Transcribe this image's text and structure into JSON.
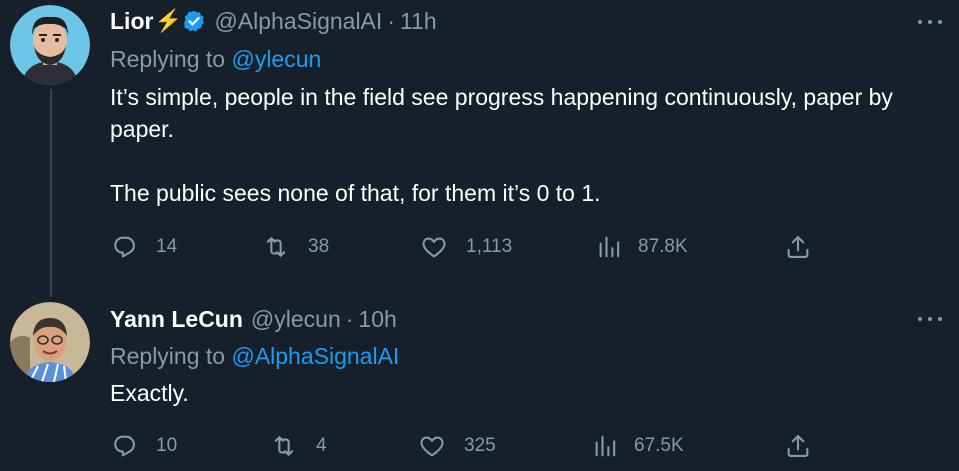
{
  "tweets": [
    {
      "name": "Lior",
      "name_emoji": "⚡",
      "handle": "@AlphaSignalAI",
      "dot": "·",
      "time": "11h",
      "replying_prefix": "Replying to",
      "replying_to": "@ylecun",
      "paragraphs": [
        "It’s simple, people in the field see progress happening continuously, paper by paper.",
        "The public sees none of that, for them it’s 0 to 1."
      ],
      "stats": {
        "replies": "14",
        "retweets": "38",
        "likes": "1,113",
        "views": "87.8K"
      }
    },
    {
      "name": "Yann LeCun",
      "handle": "@ylecun",
      "dot": "·",
      "time": "10h",
      "replying_prefix": "Replying to",
      "replying_to": "@AlphaSignalAI",
      "paragraphs": [
        "Exactly."
      ],
      "stats": {
        "replies": "10",
        "retweets": "4",
        "likes": "325",
        "views": "67.5K"
      }
    }
  ],
  "colors": {
    "background": "#15202b",
    "text": "#ffffff",
    "muted": "#8b98a5",
    "link": "#1d9bf0",
    "verified": "#1d9bf0",
    "thread_line": "#38444d"
  },
  "icons": [
    "verified-badge-icon",
    "more-options-icon",
    "reply-icon",
    "retweet-icon",
    "like-icon",
    "views-icon",
    "share-icon"
  ]
}
